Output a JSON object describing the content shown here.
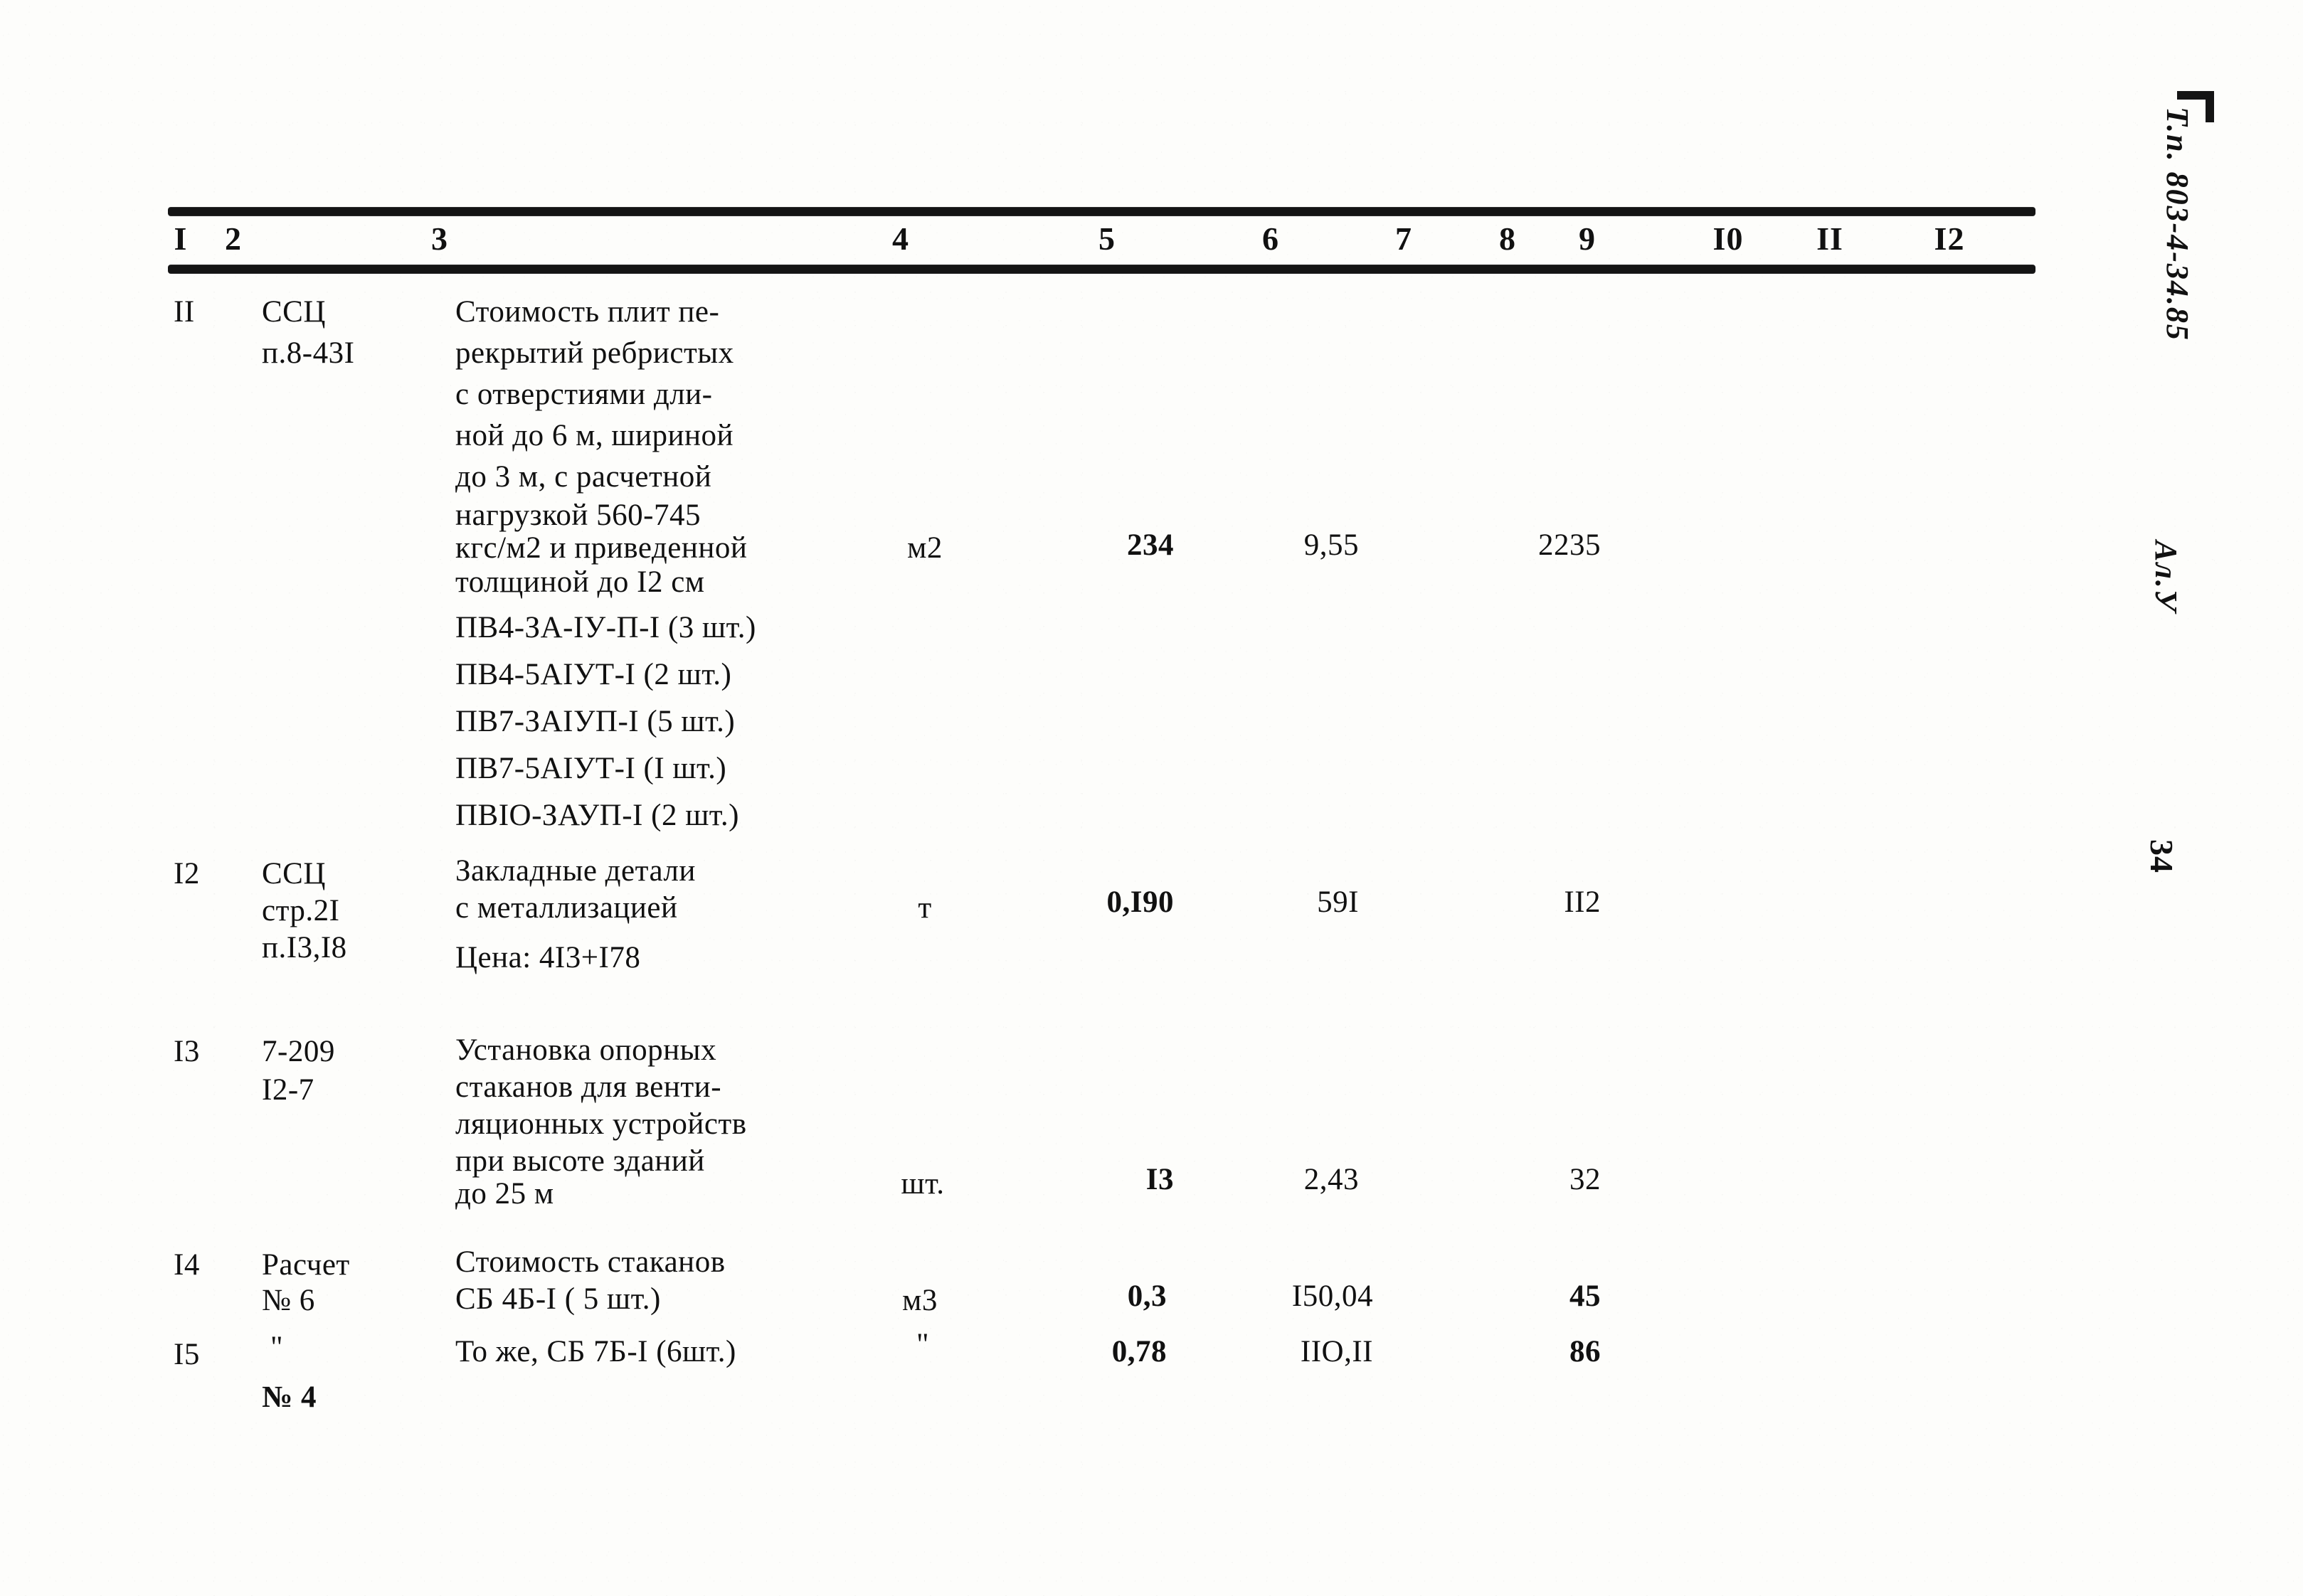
{
  "document": {
    "type": "estimate-table",
    "column_headers": [
      "I",
      "2",
      "3",
      "4",
      "5",
      "6",
      "7",
      "8",
      "9",
      "I0",
      "II",
      "I2"
    ]
  },
  "margin": {
    "stamp_code": "Т.п. 803-4-34.85",
    "stamp_album": "Ал.У",
    "page_number": "34"
  },
  "rows": [
    {
      "num": "II",
      "code_line1": "ССЦ",
      "code_line2": "п.8-43I",
      "desc_lines": [
        "Стоимость плит пе-",
        "рекрытий ребристых",
        "с отверстиями дли-",
        "ной до 6 м, шириной",
        "до 3 м, с расчетной",
        "нагрузкой 560-745",
        "кгс/м2 и приведенной",
        "толщиной до I2 см"
      ],
      "sub_items": [
        "ПВ4-ЗА-IУ-П-I (3 шт.)",
        "ПВ4-5АIУТ-I (2 шт.)",
        "ПВ7-ЗАIУП-I (5 шт.)",
        "ПВ7-5АIУТ-I (I шт.)",
        "ПВIО-ЗАУП-I (2 шт.)"
      ],
      "unit": "м2",
      "qty": "234",
      "price": "9,55",
      "total": "2235"
    },
    {
      "num": "I2",
      "code_line1": "ССЦ",
      "code_line2": "стр.2I",
      "code_line3": "п.I3,I8",
      "desc_lines": [
        "Закладные детали",
        "с металлизацией"
      ],
      "note": "Цена: 4I3+I78",
      "unit": "т",
      "qty": "0,I90",
      "price": "59I",
      "total": "II2"
    },
    {
      "num": "I3",
      "code_line1": "7-209",
      "code_line2": "I2-7",
      "desc_lines": [
        "Установка опорных",
        "стаканов для венти-",
        "ляционных устройств",
        "при высоте зданий",
        "до 25 м"
      ],
      "unit": "шт.",
      "qty": "I3",
      "price": "2,43",
      "total": "32"
    },
    {
      "num": "I4",
      "code_line1": "Расчет",
      "code_line2": "№ 6",
      "desc_lines": [
        "Стоимость стаканов",
        "СБ 4Б-I ( 5 шт.)"
      ],
      "unit": "м3",
      "qty": "0,3",
      "price": "I50,04",
      "total": "45"
    },
    {
      "num": "I5",
      "code_line1": "\"",
      "code_line2": "№ 4",
      "desc_lines": [
        "То же, СБ 7Б-I (6шт.)"
      ],
      "unit": "\"",
      "qty": "0,78",
      "price": "IIО,II",
      "total": "86"
    }
  ]
}
